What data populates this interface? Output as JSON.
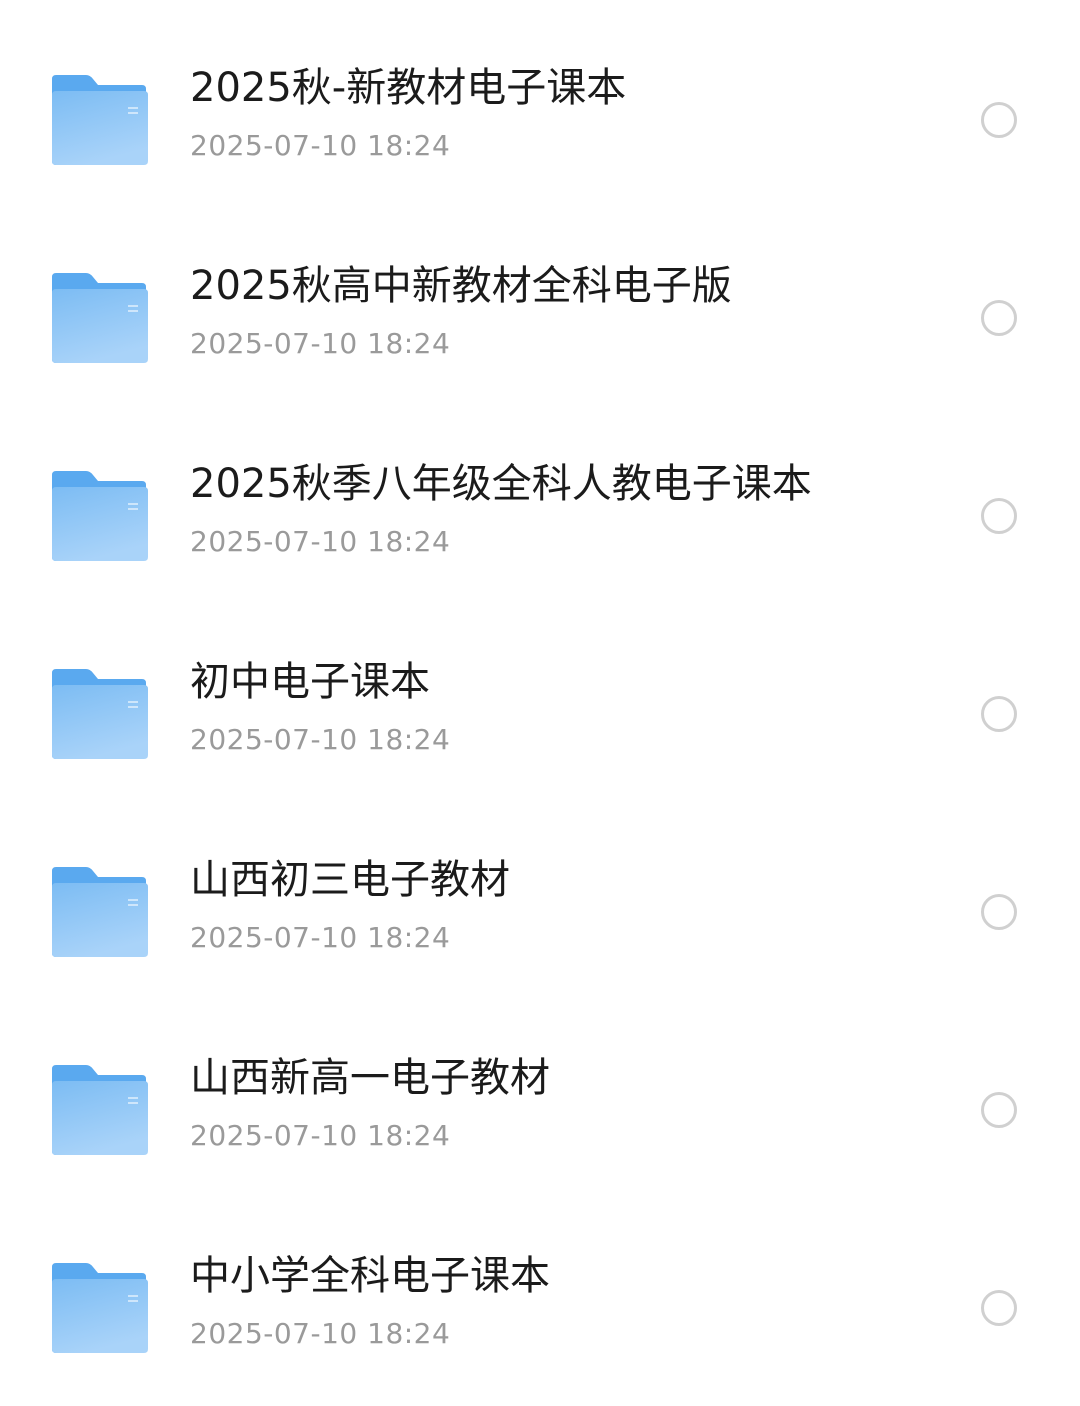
{
  "files": [
    {
      "name": "2025秋-新教材电子课本",
      "modified": "2025-07-10 18:24",
      "icon": "folder-icon",
      "selected": false
    },
    {
      "name": "2025秋高中新教材全科电子版",
      "modified": "2025-07-10 18:24",
      "icon": "folder-icon",
      "selected": false
    },
    {
      "name": "2025秋季八年级全科人教电子课本",
      "modified": "2025-07-10 18:24",
      "icon": "folder-icon",
      "selected": false
    },
    {
      "name": "初中电子课本",
      "modified": "2025-07-10 18:24",
      "icon": "folder-icon",
      "selected": false
    },
    {
      "name": "山西初三电子教材",
      "modified": "2025-07-10 18:24",
      "icon": "folder-icon",
      "selected": false
    },
    {
      "name": "山西新高一电子教材",
      "modified": "2025-07-10 18:24",
      "icon": "folder-icon",
      "selected": false
    },
    {
      "name": "中小学全科电子课本",
      "modified": "2025-07-10 18:24",
      "icon": "folder-icon",
      "selected": false
    }
  ],
  "colors": {
    "folder_back": "#5aa9ef",
    "folder_front_top": "#7cbcf3",
    "folder_front_bottom": "#a9d3f9",
    "name_text": "#1b1b1b",
    "time_text": "#9a9a9a",
    "radio_border": "#d0d0d0"
  }
}
